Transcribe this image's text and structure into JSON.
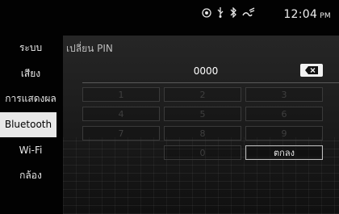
{
  "status": {
    "icons": [
      "gps-icon",
      "usb-icon",
      "bluetooth-icon",
      "phone-signal-icon"
    ],
    "time": "12:04",
    "ampm": "PM"
  },
  "sidebar": {
    "items": [
      {
        "label": "ระบบ",
        "active": false
      },
      {
        "label": "เสียง",
        "active": false
      },
      {
        "label": "การแสดงผล",
        "active": false
      },
      {
        "label": "Bluetooth",
        "active": true
      },
      {
        "label": "Wi-Fi",
        "active": false
      },
      {
        "label": "กล้อง",
        "active": false
      }
    ]
  },
  "screen": {
    "title": "เปลี่ยน PIN",
    "pin_value": "0000"
  },
  "keypad": {
    "keys": [
      "1",
      "2",
      "3",
      "4",
      "5",
      "6",
      "7",
      "8",
      "9",
      "0"
    ],
    "ok_label": "ตกลง"
  },
  "colors": {
    "active_bg": "#e8e8e8",
    "disabled_key_text": "#3f3f3f"
  }
}
